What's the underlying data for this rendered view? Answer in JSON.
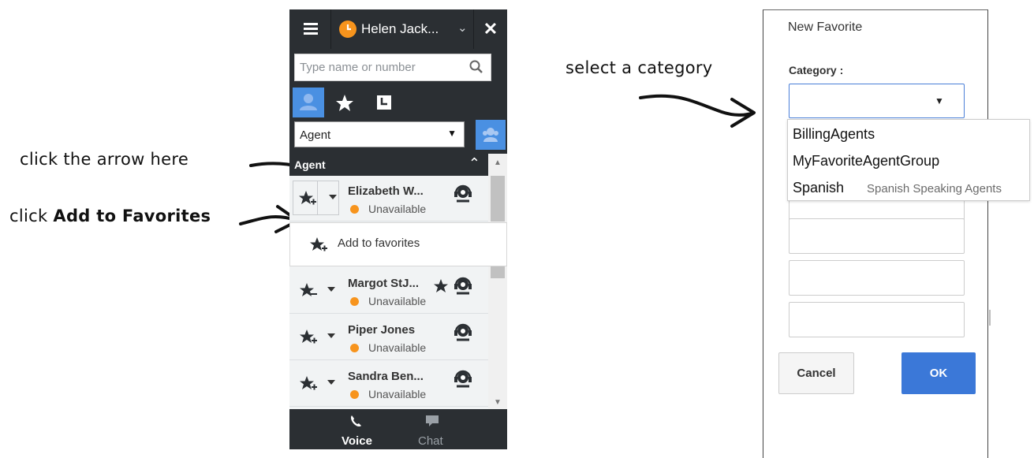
{
  "annotations": {
    "arrow_here": "click the arrow  here",
    "add_fav_prefix": "click ",
    "add_fav_bold": "Add to Favorites",
    "select_category": "select a category"
  },
  "widget": {
    "user_name": "Helen Jack...",
    "search_placeholder": "Type name or number",
    "filter_value": "Agent",
    "group_title": "Agent",
    "contacts": [
      {
        "name": "Elizabeth W...",
        "status": "Unavailable"
      },
      {
        "name": "Margot StJ...",
        "status": "Unavailable"
      },
      {
        "name": "Piper Jones",
        "status": "Unavailable"
      },
      {
        "name": "Sandra Ben...",
        "status": "Unavailable"
      }
    ],
    "context_menu": {
      "add_favorites": "Add to favorites"
    },
    "bottom_tabs": {
      "voice": "Voice",
      "chat": "Chat"
    },
    "icons": [
      "menu-icon",
      "status-icon",
      "chevron-down-icon",
      "close-icon",
      "search-icon",
      "team-icon",
      "star-icon",
      "history-icon",
      "team-communicator-icon",
      "chevron-up-icon",
      "star-add-icon",
      "star-remove-icon",
      "headset-icon",
      "phone-icon",
      "chat-icon"
    ],
    "colors": {
      "accent": "#4a90e2",
      "status": "#f7941d",
      "dark": "#2b2f33"
    }
  },
  "dialog": {
    "title": "New Favorite",
    "category_label": "Category :",
    "options": [
      {
        "name": "BillingAgents",
        "desc": ""
      },
      {
        "name": "MyFavoriteAgentGroup",
        "desc": ""
      },
      {
        "name": "Spanish",
        "desc": "Spanish Speaking Agents"
      }
    ],
    "cancel": "Cancel",
    "ok": "OK",
    "colors": {
      "ok": "#3b78d8"
    }
  }
}
